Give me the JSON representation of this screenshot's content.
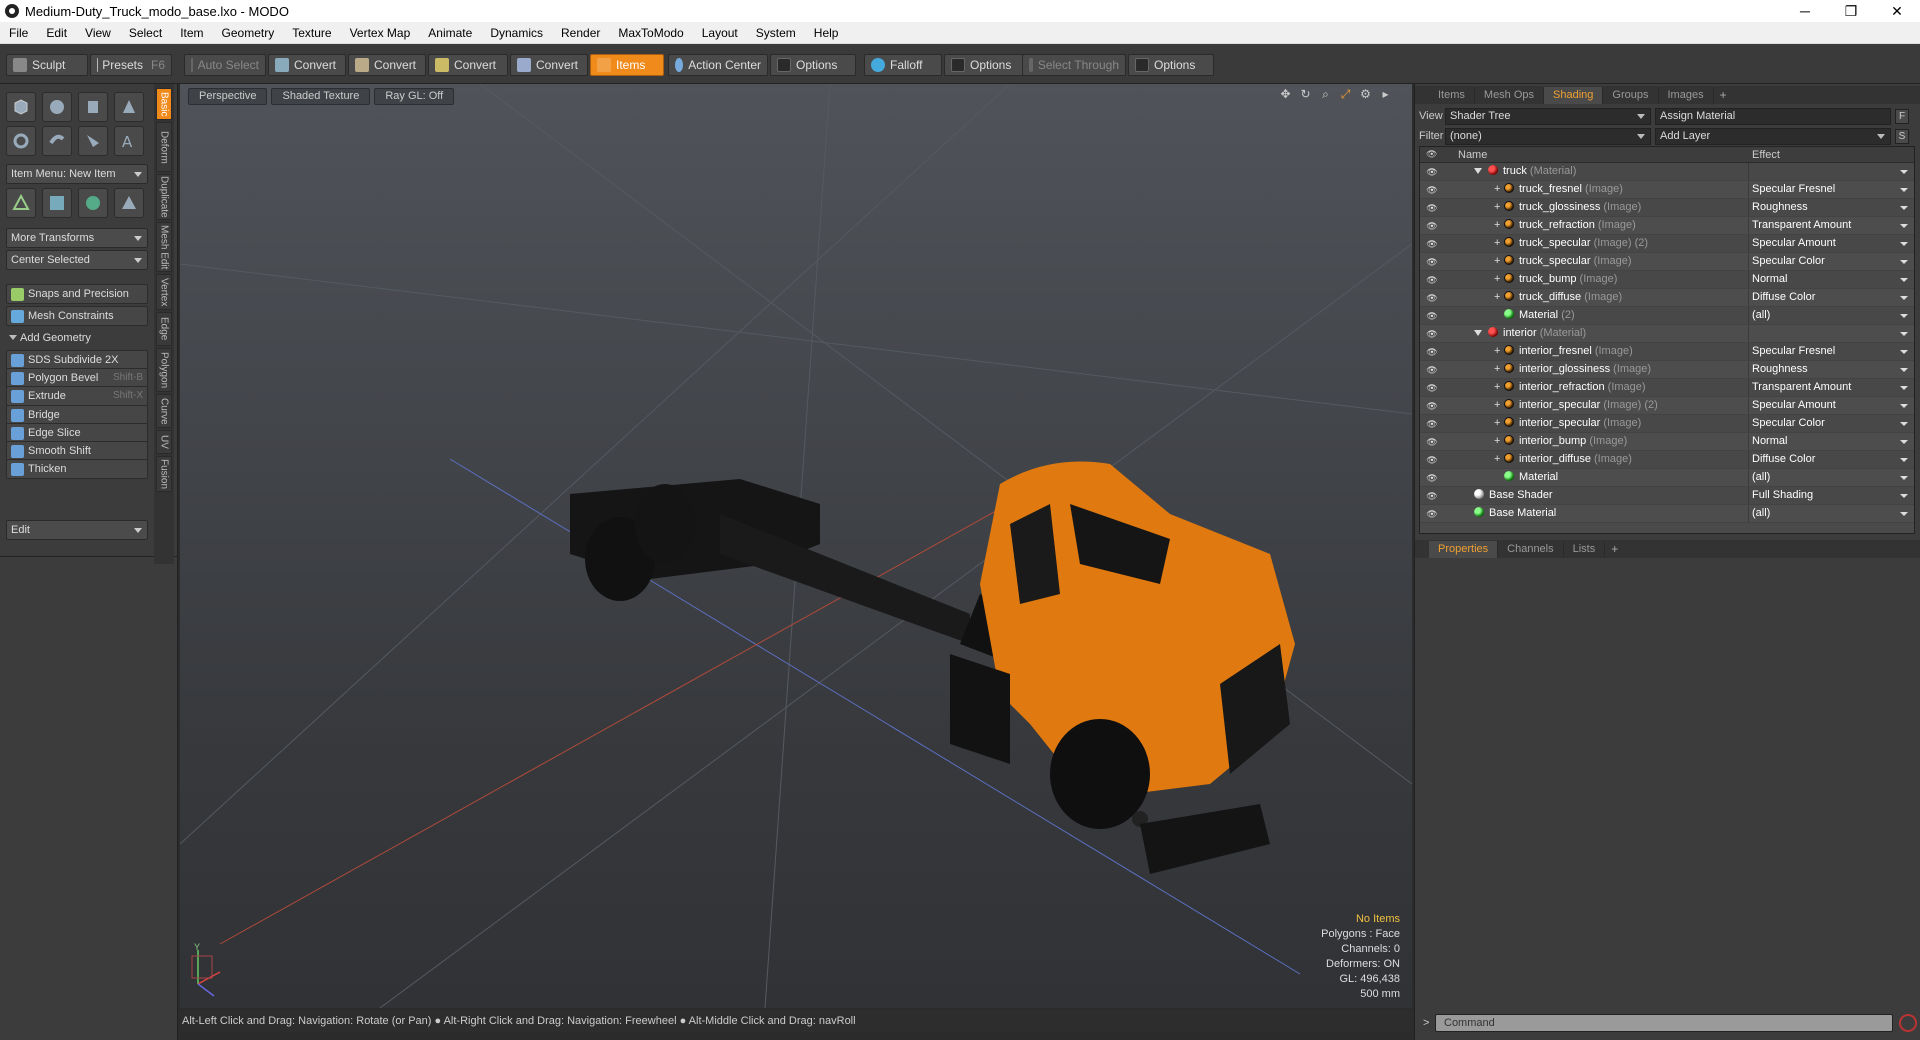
{
  "window": {
    "title": "Medium-Duty_Truck_modo_base.lxo - MODO",
    "minimize": "─",
    "maximize": "❐",
    "close": "✕"
  },
  "menu": [
    "File",
    "Edit",
    "View",
    "Select",
    "Item",
    "Geometry",
    "Texture",
    "Vertex Map",
    "Animate",
    "Dynamics",
    "Render",
    "MaxToModo",
    "Layout",
    "System",
    "Help"
  ],
  "toolbar": {
    "sculpt": "Sculpt",
    "presets": "Presets",
    "presets_key": "F6",
    "auto_select": "Auto Select",
    "convert1": "Convert",
    "convert2": "Convert",
    "convert3": "Convert",
    "convert4": "Convert",
    "items": "Items",
    "action_center": "Action Center",
    "options1": "Options",
    "falloff": "Falloff",
    "options2": "Options",
    "select_through": "Select Through",
    "options3": "Options"
  },
  "left": {
    "item_menu": "Item Menu: New Item",
    "more_transforms": "More Transforms",
    "center_selected": "Center Selected",
    "snaps": "Snaps and Precision",
    "mesh_constraints": "Mesh Constraints",
    "add_geometry": "Add Geometry",
    "tools": [
      {
        "label": "SDS Subdivide 2X",
        "key": "",
        "color": "#6aa0d8"
      },
      {
        "label": "Polygon Bevel",
        "key": "Shift-B",
        "color": "#6aa0d8"
      },
      {
        "label": "Extrude",
        "key": "Shift-X",
        "color": "#6aa0d8"
      },
      {
        "label": "Bridge",
        "key": "",
        "color": "#6aa0d8"
      },
      {
        "label": "Edge Slice",
        "key": "",
        "color": "#6aa0d8"
      },
      {
        "label": "Smooth Shift",
        "key": "",
        "color": "#6aa0d8"
      },
      {
        "label": "Thicken",
        "key": "",
        "color": "#6aa0d8"
      }
    ],
    "edit_drop": "Edit",
    "vtabs": [
      "Basic",
      "Deform",
      "Duplicate",
      "Mesh Edit",
      "Vertex",
      "Edge",
      "Polygon",
      "Curve",
      "UV",
      "Fusion"
    ]
  },
  "viewport": {
    "perspective": "Perspective",
    "shading": "Shaded Texture",
    "raygl": "Ray GL: Off",
    "stats": {
      "items": "No Items",
      "polygons": "Polygons : Face",
      "channels": "Channels: 0",
      "deformers": "Deformers: ON",
      "gl": "GL: 496,438",
      "scale": "500 mm"
    },
    "axis_y": "Y"
  },
  "status": "Alt-Left Click and Drag: Navigation: Rotate (or Pan) ● Alt-Right Click and Drag: Navigation: Freewheel ● Alt-Middle Click and Drag: navRoll",
  "right": {
    "tabs": [
      "Items",
      "Mesh Ops",
      "Shading",
      "Groups",
      "Images"
    ],
    "view_label": "View",
    "view_value": "Shader Tree",
    "assign_material": "Assign Material",
    "f_btn": "F",
    "filter_label": "Filter",
    "filter_value": "(none)",
    "add_layer": "Add Layer",
    "s_btn": "S",
    "col_name": "Name",
    "col_effect": "Effect",
    "rows": [
      {
        "indent": 0,
        "arrow": true,
        "kind": "mat",
        "name": "truck",
        "type": "(Material)",
        "effect": ""
      },
      {
        "indent": 1,
        "kind": "img",
        "name": "truck_fresnel",
        "type": "(Image)",
        "effect": "Specular Fresnel"
      },
      {
        "indent": 1,
        "kind": "img",
        "name": "truck_glossiness",
        "type": "(Image)",
        "effect": "Roughness"
      },
      {
        "indent": 1,
        "kind": "img",
        "name": "truck_refraction",
        "type": "(Image)",
        "effect": "Transparent Amount"
      },
      {
        "indent": 1,
        "kind": "img",
        "name": "truck_specular",
        "type": "(Image) (2)",
        "effect": "Specular Amount"
      },
      {
        "indent": 1,
        "kind": "img",
        "name": "truck_specular",
        "type": "(Image)",
        "effect": "Specular Color"
      },
      {
        "indent": 1,
        "kind": "img",
        "name": "truck_bump",
        "type": "(Image)",
        "effect": "Normal"
      },
      {
        "indent": 1,
        "kind": "img",
        "name": "truck_diffuse",
        "type": "(Image)",
        "effect": "Diffuse Color"
      },
      {
        "indent": 1,
        "kind": "green",
        "name": "Material",
        "type": "(2)",
        "effect": "(all)"
      },
      {
        "indent": 0,
        "arrow": true,
        "kind": "mat",
        "name": "interior",
        "type": "(Material)",
        "effect": ""
      },
      {
        "indent": 1,
        "kind": "img",
        "name": "interior_fresnel",
        "type": "(Image)",
        "effect": "Specular Fresnel"
      },
      {
        "indent": 1,
        "kind": "img",
        "name": "interior_glossiness",
        "type": "(Image)",
        "effect": "Roughness"
      },
      {
        "indent": 1,
        "kind": "img",
        "name": "interior_refraction",
        "type": "(Image)",
        "effect": "Transparent Amount"
      },
      {
        "indent": 1,
        "kind": "img",
        "name": "interior_specular",
        "type": "(Image) (2)",
        "effect": "Specular Amount"
      },
      {
        "indent": 1,
        "kind": "img",
        "name": "interior_specular",
        "type": "(Image)",
        "effect": "Specular Color"
      },
      {
        "indent": 1,
        "kind": "img",
        "name": "interior_bump",
        "type": "(Image)",
        "effect": "Normal"
      },
      {
        "indent": 1,
        "kind": "img",
        "name": "interior_diffuse",
        "type": "(Image)",
        "effect": "Diffuse Color"
      },
      {
        "indent": 1,
        "kind": "green",
        "name": "Material",
        "type": "",
        "effect": "(all)"
      },
      {
        "indent": -1,
        "kind": "white",
        "name": "Base Shader",
        "type": "",
        "effect": "Full Shading"
      },
      {
        "indent": -1,
        "kind": "green",
        "name": "Base Material",
        "type": "",
        "effect": "(all)"
      }
    ],
    "prop_tabs": [
      "Properties",
      "Channels",
      "Lists"
    ],
    "command_placeholder": "Command",
    "prompt": ">"
  },
  "colors": {
    "accent": "#f08a1a",
    "truck_body": "#e07a10"
  }
}
